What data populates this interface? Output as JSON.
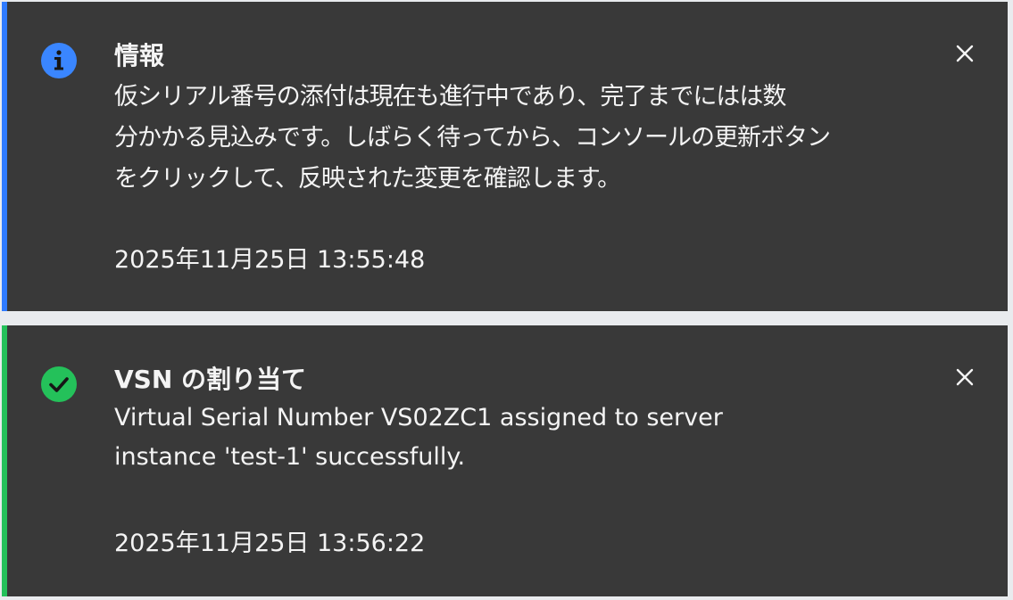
{
  "notifications": [
    {
      "kind": "info",
      "icon": "info-icon",
      "accent_color": "#2f7bff",
      "icon_color": "#3a86ff",
      "title": "情報",
      "body_lines": [
        "仮シリアル番号の添付は現在も進行中であり、完了までにはは数",
        "分かかる見込みです。しばらく待ってから、コンソールの更新ボタン",
        "をクリックして、反映された変更を確認します。"
      ],
      "timestamp": "2025年11月25日 13:55:48",
      "close_icon": "close-icon"
    },
    {
      "kind": "success",
      "icon": "checkmark-filled-icon",
      "accent_color": "#24c15a",
      "icon_color": "#24c15a",
      "title": "VSN の割り当て",
      "body_lines": [
        "Virtual Serial Number VS02ZC1 assigned to server",
        "instance 'test-1' successfully."
      ],
      "timestamp": "2025年11月25日 13:56:22",
      "close_icon": "close-icon"
    }
  ]
}
